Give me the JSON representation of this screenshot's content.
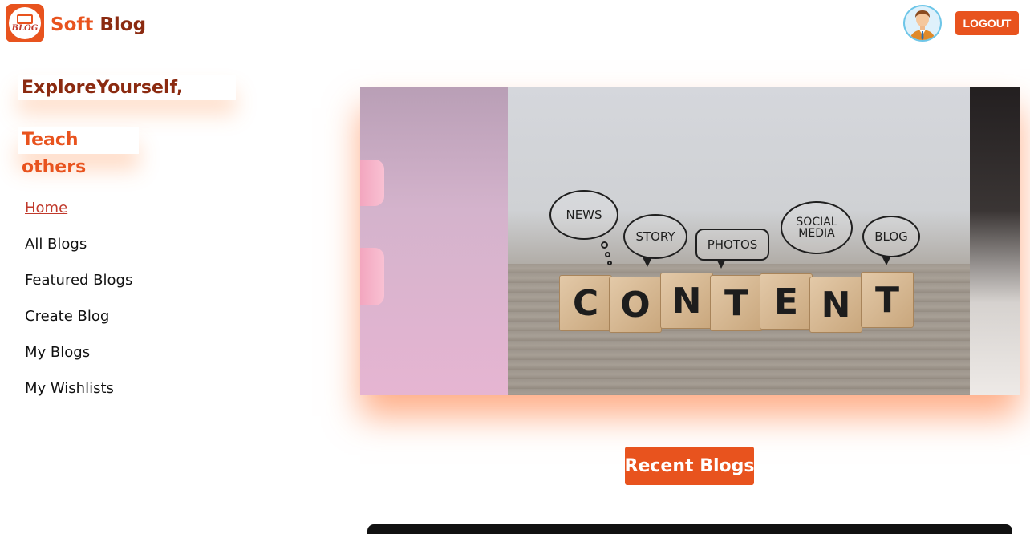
{
  "header": {
    "logo_text": "BLOG",
    "brand_first": "Soft",
    "brand_second": "Blog",
    "logout_label": "LOGOUT"
  },
  "tagline": {
    "line1": "ExploreYourself,",
    "line2": "Teach others"
  },
  "nav": {
    "items": [
      {
        "label": "Home",
        "active": true
      },
      {
        "label": "All Blogs"
      },
      {
        "label": "Featured Blogs"
      },
      {
        "label": "Create Blog"
      },
      {
        "label": "My Blogs"
      },
      {
        "label": "My Wishlists"
      }
    ]
  },
  "hero": {
    "bubbles": [
      "NEWS",
      "STORY",
      "PHOTOS",
      "SOCIAL MEDIA",
      "BLOG"
    ],
    "cubes": [
      "C",
      "O",
      "N",
      "T",
      "E",
      "N",
      "T"
    ]
  },
  "section": {
    "recent_label": "Recent Blogs"
  },
  "colors": {
    "accent": "#e8531e",
    "brand_dark": "#8b2a10",
    "active_link": "#c0392b"
  }
}
